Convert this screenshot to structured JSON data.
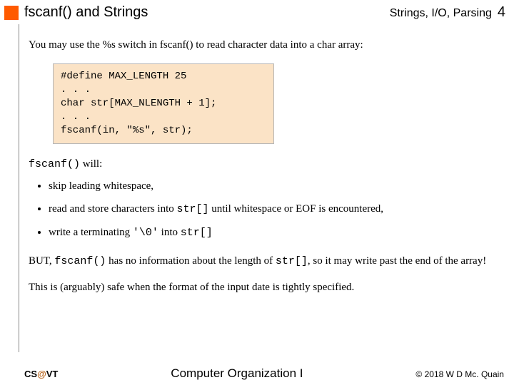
{
  "header": {
    "title": "fscanf() and Strings",
    "breadcrumb": "Strings, I/O, Parsing",
    "page": "4"
  },
  "intro": "You may use the %s switch in fscanf() to read character data into a char array:",
  "code": "#define MAX_LENGTH 25\n. . .\nchar str[MAX_NLENGTH + 1];\n. . .\nfscanf(in, \"%s\", str);",
  "will": {
    "prefix": "fscanf()",
    "suffix": " will:"
  },
  "bullets": [
    {
      "pre": "skip leading whitespace,"
    },
    {
      "pre": "read and store characters into ",
      "code": "str[]",
      "post": " until whitespace or EOF is encountered,"
    },
    {
      "pre": "write a terminating ",
      "code": "'\\0'",
      "mid": " into ",
      "code2": "str[]"
    }
  ],
  "but": {
    "a": "BUT, ",
    "b": "fscanf()",
    "c": " has no information about the length of ",
    "d": "str[]",
    "e": ", so it may write past the end of the array!"
  },
  "safe": "This is (arguably) safe when the format of the input date is tightly specified.",
  "footer": {
    "left_a": "CS",
    "left_b": "@",
    "left_c": "VT",
    "center": "Computer Organization I",
    "right": "© 2018 W D Mc. Quain"
  }
}
